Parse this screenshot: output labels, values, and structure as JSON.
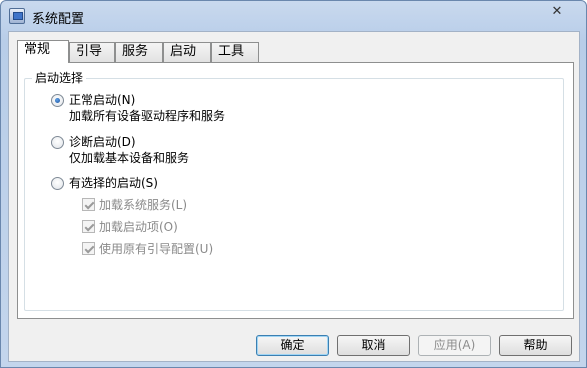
{
  "window": {
    "title": "系统配置",
    "close_label": "✕"
  },
  "tabs": [
    {
      "label": "常规",
      "active": true
    },
    {
      "label": "引导",
      "active": false
    },
    {
      "label": "服务",
      "active": false
    },
    {
      "label": "启动",
      "active": false
    },
    {
      "label": "工具",
      "active": false
    }
  ],
  "startup_group": {
    "legend": "启动选择",
    "normal": {
      "label": "正常启动(N)",
      "description": "加载所有设备驱动程序和服务",
      "selected": true
    },
    "diagnostic": {
      "label": "诊断启动(D)",
      "description": "仅加载基本设备和服务",
      "selected": false
    },
    "selective": {
      "label": "有选择的启动(S)",
      "selected": false,
      "options": [
        {
          "label": "加载系统服务(L)",
          "checked": true,
          "enabled": false
        },
        {
          "label": "加载启动项(O)",
          "checked": true,
          "enabled": false
        },
        {
          "label": "使用原有引导配置(U)",
          "checked": true,
          "enabled": false
        }
      ]
    }
  },
  "buttons": {
    "ok": "确定",
    "cancel": "取消",
    "apply": "应用(A)",
    "help": "帮助"
  }
}
